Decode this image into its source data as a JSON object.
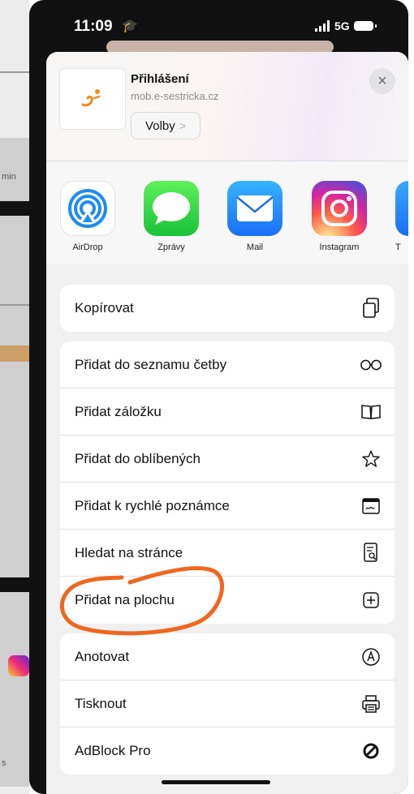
{
  "status": {
    "time": "11:09",
    "network": "5G"
  },
  "share_header": {
    "title": "Přihlášení",
    "url": "mob.e-sestricka.cz",
    "options_label": "Volby",
    "options_chevron": ">",
    "close": "×"
  },
  "apps": [
    {
      "label": "AirDrop",
      "icon": "airdrop-icon"
    },
    {
      "label": "Zprávy",
      "icon": "messages-icon"
    },
    {
      "label": "Mail",
      "icon": "mail-icon"
    },
    {
      "label": "Instagram",
      "icon": "instagram-icon"
    },
    {
      "label": "T",
      "icon": "app-icon"
    }
  ],
  "actions": {
    "group1": [
      {
        "label": "Kopírovat",
        "icon": "copy-icon"
      }
    ],
    "group2": [
      {
        "label": "Přidat do seznamu četby",
        "icon": "glasses-icon"
      },
      {
        "label": "Přidat záložku",
        "icon": "book-icon"
      },
      {
        "label": "Přidat do oblíbených",
        "icon": "star-icon"
      },
      {
        "label": "Přidat k rychlé poznámce",
        "icon": "quick-note-icon"
      },
      {
        "label": "Hledat na stránce",
        "icon": "find-on-page-icon"
      },
      {
        "label": "Přidat na plochu",
        "icon": "add-square-icon"
      }
    ],
    "group3": [
      {
        "label": "Anotovat",
        "icon": "markup-icon"
      },
      {
        "label": "Tisknout",
        "icon": "print-icon"
      },
      {
        "label": "AdBlock Pro",
        "icon": "block-icon"
      }
    ]
  },
  "background_hints": {
    "text1": "min",
    "text2": "s"
  },
  "colors": {
    "annotation": "#f0661e",
    "sheet": "#f1f0f1"
  }
}
